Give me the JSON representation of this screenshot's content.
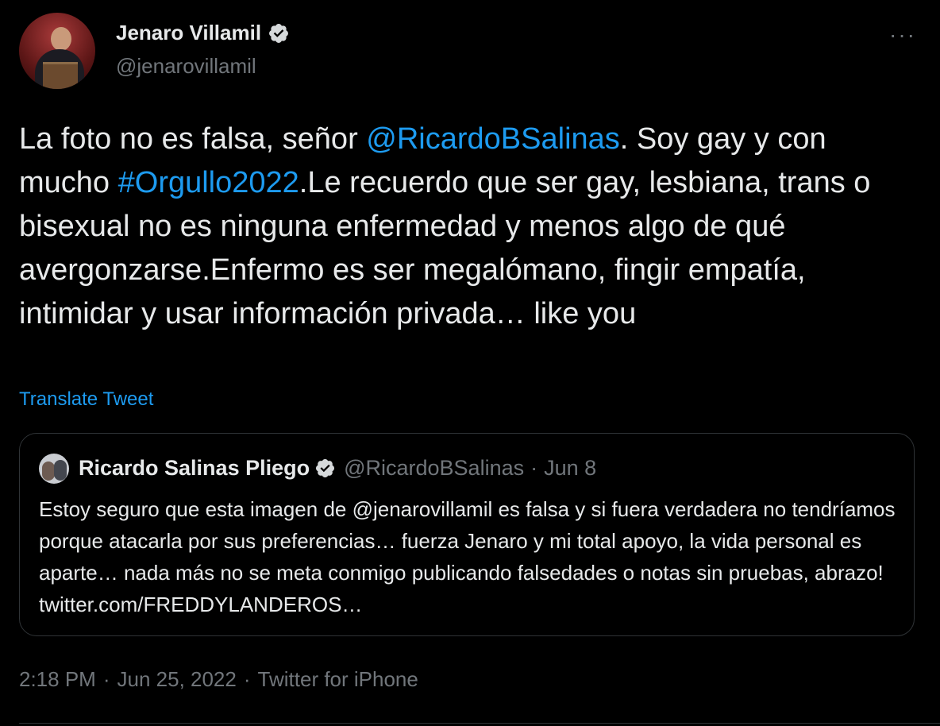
{
  "author": {
    "name": "Jenaro Villamil",
    "handle": "@jenarovillamil",
    "verified": true,
    "avatar_icon": "avatar-photo-speaker-at-podium"
  },
  "more_menu": {
    "label": "···",
    "icon": "more-options-icon"
  },
  "tweet": {
    "segments": [
      {
        "text": "La foto no es falsa, señor ",
        "type": "text"
      },
      {
        "text": "@RicardoBSalinas",
        "type": "mention"
      },
      {
        "text": ". Soy gay y con mucho ",
        "type": "text"
      },
      {
        "text": "#Orgullo2022",
        "type": "hashtag"
      },
      {
        "text": ".Le recuerdo que ser gay, lesbiana, trans o bisexual no es ninguna enfermedad y menos algo de qué avergonzarse.Enfermo es ser megalómano, fingir empatía, intimidar y usar información privada… like you",
        "type": "text"
      }
    ],
    "translate_label": "Translate Tweet"
  },
  "quoted_tweet": {
    "name": "Ricardo Salinas Pliego",
    "handle": "@RicardoBSalinas",
    "separator": "·",
    "date": "Jun 8",
    "verified": true,
    "text": "Estoy seguro que esta imagen de @jenarovillamil es falsa y si fuera verdadera no tendríamos porque atacarla por sus preferencias… fuerza Jenaro y mi total apoyo, la vida personal es aparte… nada más no se meta conmigo publicando falsedades o notas sin pruebas, abrazo! twitter.com/FREDDYLANDEROS…"
  },
  "footer": {
    "time": "2:18 PM",
    "separator": "·",
    "date": "Jun 25, 2022",
    "source": "Twitter for iPhone"
  },
  "colors": {
    "background": "#000000",
    "text": "#e7e9ea",
    "secondary": "#71767b",
    "link": "#1d9bf0",
    "border": "#2f3336"
  }
}
